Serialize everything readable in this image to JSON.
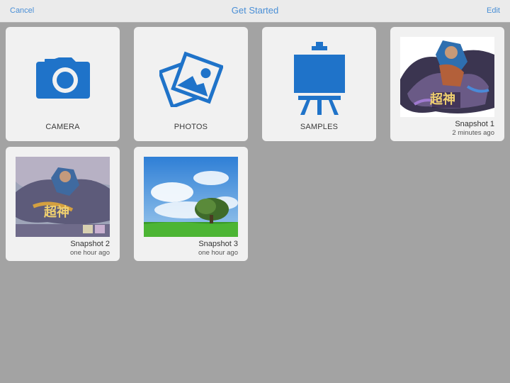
{
  "navbar": {
    "cancel_label": "Cancel",
    "title": "Get Started",
    "edit_label": "Edit"
  },
  "tiles": {
    "camera": {
      "label": "CAMERA",
      "icon": "camera-icon"
    },
    "photos": {
      "label": "PHOTOS",
      "icon": "photos-icon"
    },
    "samples": {
      "label": "SAMPLES",
      "icon": "easel-icon"
    }
  },
  "snapshots": [
    {
      "name": "Snapshot 1",
      "time": "2 minutes ago",
      "thumb_text": "超神"
    },
    {
      "name": "Snapshot 2",
      "time": "one hour ago",
      "thumb_text": "超神"
    },
    {
      "name": "Snapshot 3",
      "time": "one hour ago"
    }
  ],
  "colors": {
    "accent": "#4a8fd6",
    "icon_blue": "#1f73c9",
    "background": "#a3a3a3",
    "tile": "#f1f1f1",
    "navbar": "#ebebeb"
  }
}
